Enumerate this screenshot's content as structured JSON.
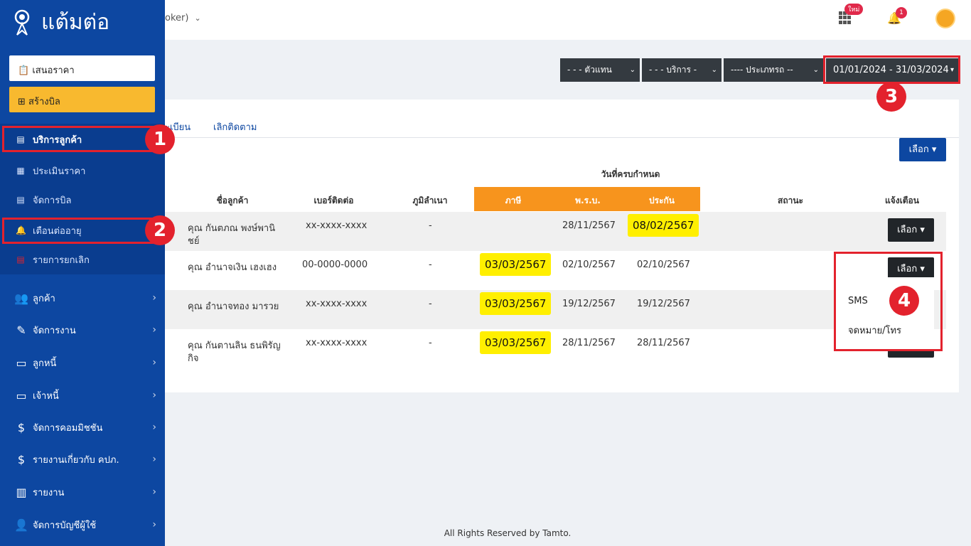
{
  "app": {
    "name": "แต้มต่อ"
  },
  "header": {
    "broker_text": "oker)",
    "new_badge": "ใหม่",
    "notification_count": "1"
  },
  "sidebar": {
    "quote_button": "เสนอราคา",
    "create_bill_button": "สร้างบิล",
    "sub_items": [
      {
        "label": "บริการลูกค้า"
      },
      {
        "label": "ประเมินราคา"
      },
      {
        "label": "จัดการบิล"
      },
      {
        "label": "เตือนต่ออายุ"
      },
      {
        "label": "รายการยกเลิก"
      }
    ],
    "main_items": [
      {
        "label": "ลูกค้า"
      },
      {
        "label": "จัดการงาน"
      },
      {
        "label": "ลูกหนี้"
      },
      {
        "label": "เจ้าหนี้"
      },
      {
        "label": "จัดการคอมมิชชัน"
      },
      {
        "label": "รายงานเกี่ยวกับ คปภ."
      },
      {
        "label": "รายงาน"
      },
      {
        "label": "จัดการบัญชีผู้ใช้"
      }
    ]
  },
  "filters": {
    "agent": "- - - ตัวแทน",
    "service": "- - - บริการ -",
    "vehicle_type": "---- ประเภทรถ --",
    "date_range": "01/01/2024 - 31/03/2024"
  },
  "tabs": [
    "ะเบียน",
    "เลิกติดตาม"
  ],
  "select_button": "เลือก",
  "table": {
    "group_header": "วันที่ครบกำหนด",
    "headers": {
      "customer": "ชื่อลูกค้า",
      "phone": "เบอร์ติดต่อ",
      "domicile": "ภูมิลำเนา",
      "tax": "ภาษี",
      "prb": "พ.ร.บ.",
      "insurance": "ประกัน",
      "status": "สถานะ",
      "notify": "แจ้งเตือน"
    },
    "rows": [
      {
        "customer": "คุณ กันตภณ พงษ์พานิ",
        "customer_line2": "ชย์",
        "phone": "xx-xxxx-xxxx",
        "domicile": "-",
        "tax": "",
        "prb": "28/11/2567",
        "insurance": "08/02/2567"
      },
      {
        "customer": "คุณ อำนาจเงิน เฮงเฮง",
        "customer_line2": "",
        "phone": "00-0000-0000",
        "domicile": "-",
        "tax": "03/03/2567",
        "prb": "02/10/2567",
        "insurance": "02/10/2567"
      },
      {
        "customer": "คุณ อำนาจทอง มารวย",
        "customer_line2": "",
        "phone": "xx-xxxx-xxxx",
        "domicile": "-",
        "tax": "03/03/2567",
        "prb": "19/12/2567",
        "insurance": "19/12/2567"
      },
      {
        "customer": "คุณ กันตานลิน ธนพิรัญ",
        "customer_line2": "กิจ",
        "phone": "xx-xxxx-xxxx",
        "domicile": "-",
        "tax": "03/03/2567",
        "prb": "28/11/2567",
        "insurance": "28/11/2567"
      }
    ]
  },
  "dropdown_menu": {
    "items": [
      "SMS",
      "จดหมาย/โทร"
    ]
  },
  "callouts": [
    "1",
    "2",
    "3",
    "4"
  ],
  "footer": "All Rights Reserved by Tamto.",
  "colors": {
    "sidebar": "#0d47a1",
    "accent_yellow": "#ffef00",
    "orange_header": "#f7941d",
    "callout_red": "#e3222d"
  }
}
